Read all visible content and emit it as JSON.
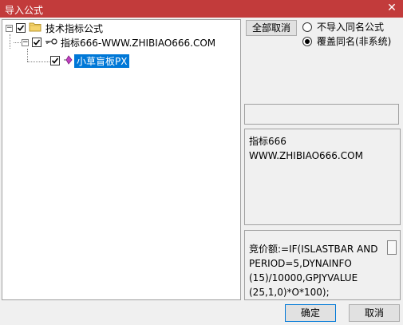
{
  "window": {
    "title": "导入公式",
    "close_glyph": "✕"
  },
  "tree": {
    "root": {
      "label": "技术指标公式",
      "expander": "⊟"
    },
    "child": {
      "label": "指标666-WWW.ZHIBIAO666.COM",
      "expander": "⊟"
    },
    "leaf": {
      "label": "小草盲板PX"
    }
  },
  "options": {
    "select_all_label": "全部取消",
    "radio_no_import": "不导入同名公式",
    "radio_overwrite": "覆盖同名(非系统)",
    "selected": "overwrite"
  },
  "info": {
    "line1": "指标666",
    "line2": "WWW.ZHIBIAO666.COM"
  },
  "formula": {
    "line1": "竞价额:=IF(ISLASTBAR AND",
    "line2": "PERIOD=5,DYNAINFO",
    "line3": "(15)/10000,GPJYVALUE",
    "line4": "(25,1,0)*O*100);"
  },
  "buttons": {
    "ok": "确定",
    "cancel": "取消"
  },
  "colors": {
    "titlebar": "#c23b3b",
    "selection": "#0078d7"
  }
}
